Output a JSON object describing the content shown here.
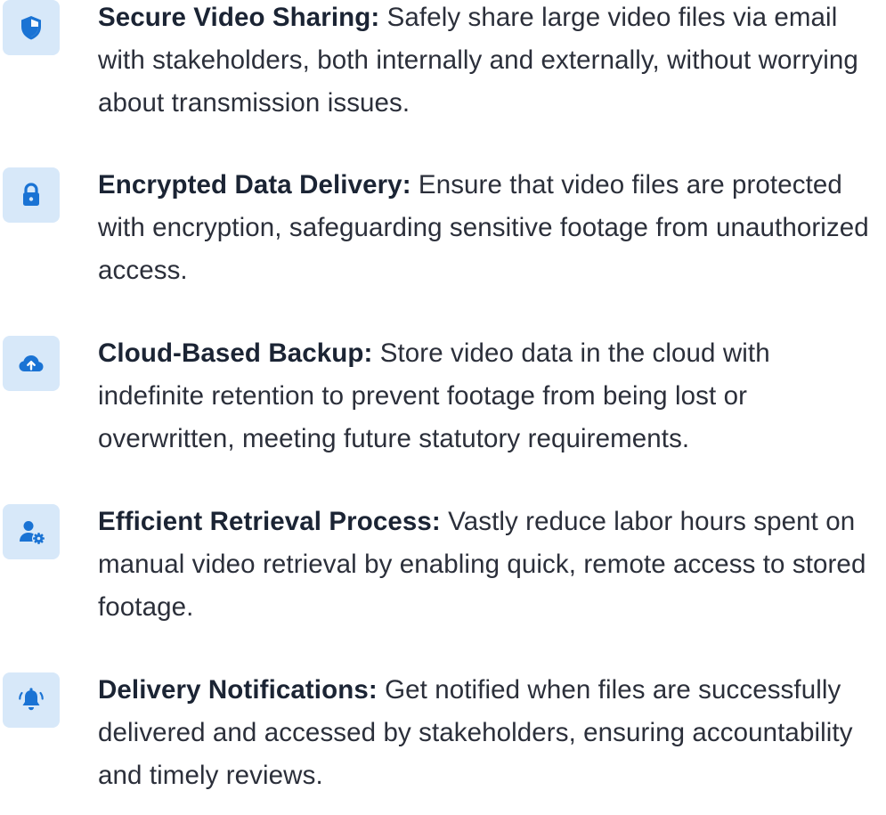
{
  "features": [
    {
      "icon": "shield-icon",
      "title": "Secure Video Sharing:",
      "text": "Safely share large video files via email with stakeholders, both internally and externally, without worrying about transmission issues."
    },
    {
      "icon": "lock-icon",
      "title": "Encrypted Data Delivery:",
      "text": "Ensure that video files are protected with encryption, safeguarding sensitive footage from unauthorized access."
    },
    {
      "icon": "cloud-upload-icon",
      "title": "Cloud-Based Backup:",
      "text": "Store video data in the cloud with indefinite retention to prevent footage from being lost or overwritten, meeting future statutory requirements."
    },
    {
      "icon": "user-gear-icon",
      "title": "Efficient Retrieval Process:",
      "text": "Vastly reduce labor hours spent on manual video retrieval by enabling quick, remote access to stored footage."
    },
    {
      "icon": "bell-ringing-icon",
      "title": "Delivery Notifications:",
      "text": "Get notified when files are successfully delivered and accessed by stakeholders, ensuring accountability and timely reviews."
    }
  ],
  "colors": {
    "icon_tile_bg": "#d7e8f9",
    "icon_blue": "#1a73d4",
    "title_text": "#1b2434",
    "body_text": "#2b2f3a"
  }
}
